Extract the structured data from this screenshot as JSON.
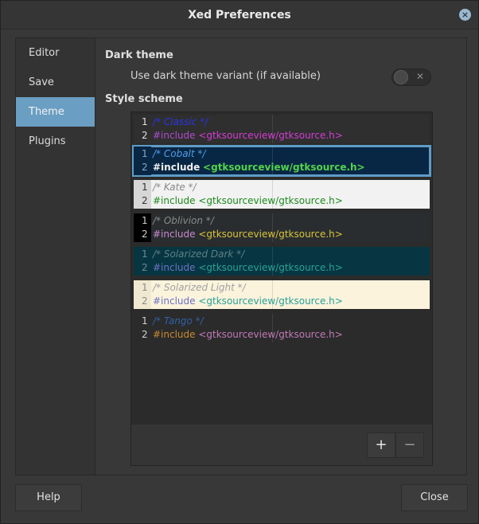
{
  "window": {
    "title": "Xed Preferences"
  },
  "sidebar": {
    "items": [
      {
        "label": "Editor"
      },
      {
        "label": "Save"
      },
      {
        "label": "Theme"
      },
      {
        "label": "Plugins"
      }
    ],
    "active_index": 2
  },
  "dark_theme": {
    "heading": "Dark theme",
    "option_label": "Use dark theme variant (if available)",
    "enabled": false
  },
  "style_scheme": {
    "heading": "Style scheme",
    "schemes": [
      {
        "comment": "/* Classic */",
        "include_kw": "#include",
        "include_path": "<gtksourceview/gtksource.h>",
        "bg": "#2f2f2f",
        "gutter_bg": "#2f2f2f",
        "ln_color": "#e0e0e0",
        "comment_color": "#2b33e6",
        "kw_color": "#b04bd0",
        "path_color": "#d33cd3",
        "selected": false
      },
      {
        "comment": "/* Cobalt */",
        "include_kw": "#include",
        "include_path": "<gtksourceview/gtksource.h>",
        "bg": "#082745",
        "gutter_bg": "#082745",
        "ln_color": "#8aa6bf",
        "comment_color": "#4f9ee8",
        "kw_color": "#f0f0f0",
        "path_color": "#52d34a",
        "selected": true
      },
      {
        "comment": "/* Kate */",
        "include_kw": "#include",
        "include_path": "<gtksourceview/gtksource.h>",
        "bg": "#f2f2f2",
        "gutter_bg": "#d6d6d6",
        "ln_color": "#333333",
        "comment_color": "#888888",
        "kw_color": "#1c8a1c",
        "path_color": "#1c8a1c",
        "selected": false
      },
      {
        "comment": "/* Oblivion */",
        "include_kw": "#include",
        "include_path": "<gtksourceview/gtksource.h>",
        "bg": "#2a2d2f",
        "gutter_bg": "#000000",
        "ln_color": "#cfcfcf",
        "comment_color": "#8a8a8a",
        "kw_color": "#c98ad0",
        "path_color": "#d6c43c",
        "selected": false
      },
      {
        "comment": "/* Solarized Dark */",
        "include_kw": "#include",
        "include_path": "<gtksourceview/gtksource.h>",
        "bg": "#073642",
        "gutter_bg": "#073642",
        "ln_color": "#6f8a92",
        "comment_color": "#5f7f86",
        "kw_color": "#6c71c4",
        "path_color": "#2aa198",
        "selected": false
      },
      {
        "comment": "/* Solarized Light */",
        "include_kw": "#include",
        "include_path": "<gtksourceview/gtksource.h>",
        "bg": "#fbf3dc",
        "gutter_bg": "#f0e8d0",
        "ln_color": "#8a8a8a",
        "comment_color": "#a0a0a0",
        "kw_color": "#6c71c4",
        "path_color": "#2aa198",
        "selected": false
      },
      {
        "comment": "/* Tango */",
        "include_kw": "#include",
        "include_path": "<gtksourceview/gtksource.h>",
        "bg": "#2b2b2b",
        "gutter_bg": "#2b2b2b",
        "ln_color": "#d0d0d0",
        "comment_color": "#3060a8",
        "kw_color": "#c98a2e",
        "path_color": "#c07ab8",
        "selected": false
      }
    ],
    "add_label": "+",
    "remove_label": "−"
  },
  "footer": {
    "help_label": "Help",
    "close_label": "Close"
  },
  "colors": {
    "accent": "#6a9ec3",
    "window_bg": "#383838"
  }
}
